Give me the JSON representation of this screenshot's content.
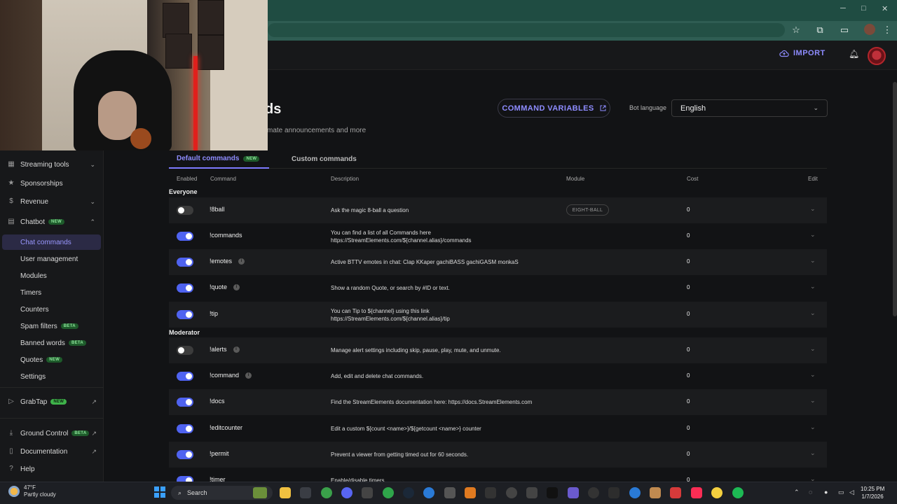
{
  "header": {
    "import_label": "IMPORT"
  },
  "page": {
    "title": "ds",
    "subtitle": "mate announcements and more",
    "command_variables_label": "COMMAND VARIABLES",
    "bot_language_label": "Bot language",
    "bot_language_value": "English"
  },
  "sidebar": {
    "items": [
      {
        "label": "Streaming tools",
        "icon": "grid-icon"
      },
      {
        "label": "Sponsorships",
        "icon": "star-icon"
      },
      {
        "label": "Revenue",
        "icon": "dollar-icon"
      },
      {
        "label": "Chatbot",
        "icon": "chat-icon",
        "badge": "NEW"
      },
      {
        "label": "Chat commands",
        "active": true
      },
      {
        "label": "User management"
      },
      {
        "label": "Modules"
      },
      {
        "label": "Timers"
      },
      {
        "label": "Counters"
      },
      {
        "label": "Spam filters",
        "badge": "BETA"
      },
      {
        "label": "Banned words",
        "badge": "BETA"
      },
      {
        "label": "Quotes",
        "badge": "NEW"
      },
      {
        "label": "Settings"
      },
      {
        "label": "GrabTap",
        "badge": "NEW"
      },
      {
        "label": "Ground Control",
        "badge": "BETA"
      },
      {
        "label": "Documentation"
      },
      {
        "label": "Help"
      }
    ]
  },
  "tabs": {
    "default_label": "Default commands",
    "default_badge": "NEW",
    "custom_label": "Custom commands"
  },
  "table": {
    "headers": {
      "enabled": "Enabled",
      "command": "Command",
      "description": "Description",
      "module": "Module",
      "cost": "Cost",
      "edit": "Edit"
    },
    "section_everyone": "Everyone",
    "section_moderator": "Moderator",
    "rows": [
      {
        "name": "!8ball",
        "enabled": false,
        "info": false,
        "desc1": "Ask the magic 8-ball a question",
        "desc2": "",
        "module": "EIGHT-BALL",
        "cost": "0"
      },
      {
        "name": "!commands",
        "enabled": true,
        "info": false,
        "desc1": "You can find a list of all Commands here",
        "desc2": "https://StreamElements.com/${channel.alias}/commands",
        "module": "",
        "cost": "0"
      },
      {
        "name": "!emotes",
        "enabled": true,
        "info": true,
        "desc1": "Active BTTV emotes in chat: Clap KKaper gachiBASS gachiGASM monkaS",
        "desc2": "",
        "module": "",
        "cost": "0"
      },
      {
        "name": "!quote",
        "enabled": true,
        "info": true,
        "desc1": "Show a random Quote, or search by #ID or text.",
        "desc2": "",
        "module": "",
        "cost": "0"
      },
      {
        "name": "!tip",
        "enabled": true,
        "info": false,
        "desc1": "You can Tip to ${channel} using this link",
        "desc2": "https://StreamElements.com/${channel.alias}/tip",
        "module": "",
        "cost": "0"
      },
      {
        "name": "!alerts",
        "enabled": false,
        "info": true,
        "desc1": "Manage alert settings including skip, pause, play, mute, and unmute.",
        "desc2": "",
        "module": "",
        "cost": "0"
      },
      {
        "name": "!command",
        "enabled": true,
        "info": true,
        "desc1": "Add, edit and delete chat commands.",
        "desc2": "",
        "module": "",
        "cost": "0"
      },
      {
        "name": "!docs",
        "enabled": true,
        "info": false,
        "desc1": "Find the StreamElements documentation here: https://docs.StreamElements.com",
        "desc2": "",
        "module": "",
        "cost": "0"
      },
      {
        "name": "!editcounter",
        "enabled": true,
        "info": false,
        "desc1": "Edit a custom ${count <name>}/${getcount <name>} counter",
        "desc2": "",
        "module": "",
        "cost": "0"
      },
      {
        "name": "!permit",
        "enabled": true,
        "info": false,
        "desc1": "Prevent a viewer from getting timed out for 60 seconds.",
        "desc2": "",
        "module": "",
        "cost": "0"
      },
      {
        "name": "!timer",
        "enabled": true,
        "info": false,
        "desc1": "Enable/disable timers",
        "desc2": "",
        "module": "",
        "cost": "0"
      }
    ]
  },
  "taskbar": {
    "temperature": "47°F",
    "weather": "Partly cloudy",
    "search_placeholder": "Search",
    "time": "10:25 PM",
    "date": "1/7/2026"
  },
  "colors": {
    "accent": "#8e8cff",
    "toggle_on": "#4f63f0",
    "browser": "#1f4c42"
  }
}
